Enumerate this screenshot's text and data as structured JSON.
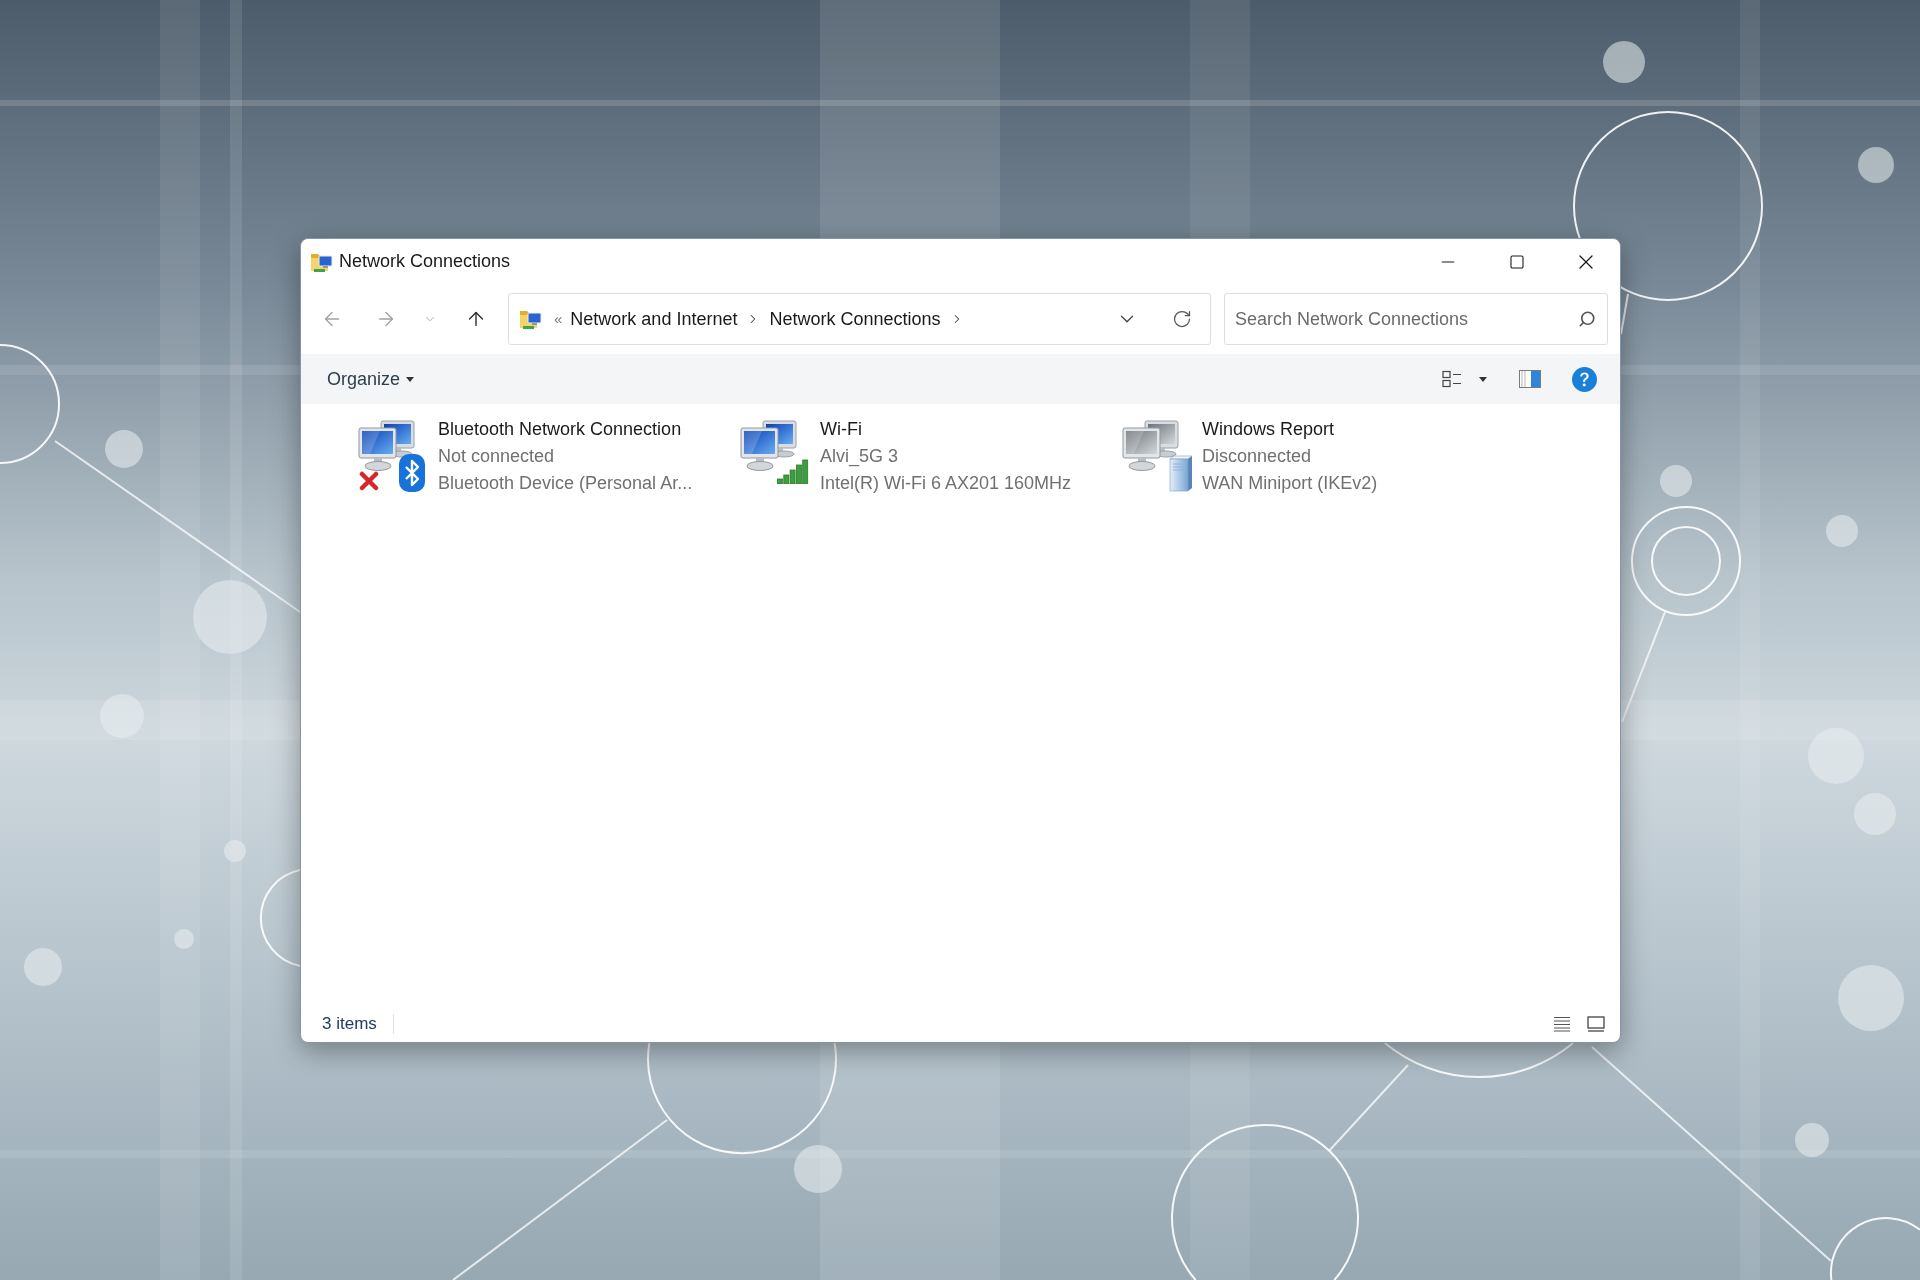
{
  "window": {
    "title": "Network Connections"
  },
  "navigation": [
    {
      "kind": "back",
      "disabled": true
    },
    {
      "kind": "forward",
      "disabled": true
    },
    {
      "kind": "recent",
      "disabled": true
    },
    {
      "kind": "up",
      "disabled": false
    }
  ],
  "address_bar": {
    "overflow": "«",
    "breadcrumbs": [
      "Network and Internet",
      "Network Connections"
    ]
  },
  "search": {
    "placeholder": "Search Network Connections"
  },
  "toolbar": {
    "organize": "Organize"
  },
  "items": [
    {
      "kind": "bluetooth",
      "name": "Bluetooth Network Connection",
      "status": "Not connected",
      "device": "Bluetooth Device (Personal Ar..."
    },
    {
      "kind": "wifi",
      "name": "Wi-Fi",
      "status": "Alvi_5G 3",
      "device": "Intel(R) Wi-Fi 6 AX201 160MHz"
    },
    {
      "kind": "wan",
      "name": "Windows Report",
      "status": "Disconnected",
      "device": "WAN Miniport (IKEv2)"
    }
  ],
  "status_bar": {
    "count": "3 items"
  }
}
